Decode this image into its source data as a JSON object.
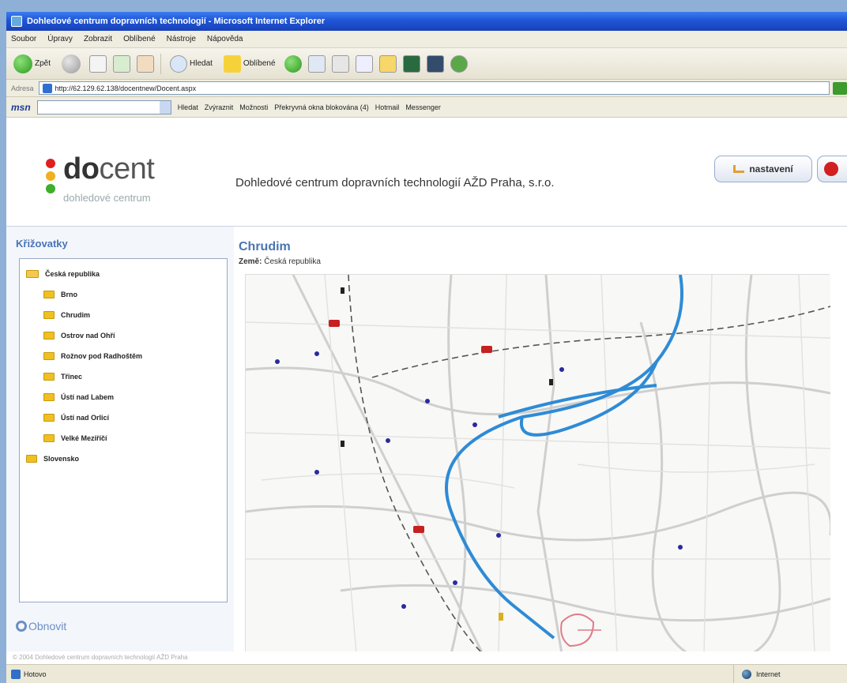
{
  "window": {
    "title": "Dohledové centrum dopravních technologií - Microsoft Internet Explorer"
  },
  "menu": [
    "Soubor",
    "Úpravy",
    "Zobrazit",
    "Oblíbené",
    "Nástroje",
    "Nápověda"
  ],
  "toolbar": {
    "back_label": "Zpět",
    "search_label": "Hledat",
    "favorites_label": "Oblíbené"
  },
  "address": {
    "label": "Adresa",
    "url": "http://62.129.62.138/docentnew/Docent.aspx"
  },
  "msn": {
    "logo": "msn",
    "search_label": "Hledat",
    "highlight_label": "Zvýraznit",
    "options_label": "Možnosti",
    "popups_label": "Překryvná okna blokována (4)",
    "hotmail_label": "Hotmail",
    "messenger_label": "Messenger"
  },
  "header": {
    "logo_bold": "do",
    "logo_rest": "cent",
    "logo_sub": "dohledové centrum",
    "company": "Dohledové centrum dopravních technologií AŽD Praha, s.r.o.",
    "settings_label": "nastavení",
    "dot_colors": [
      "#e02020",
      "#f0b020",
      "#3fae2c"
    ]
  },
  "sidebar": {
    "title": "Křižovatky",
    "tree": [
      {
        "label": "Česká republika",
        "level": 0,
        "open": true
      },
      {
        "label": "Brno",
        "level": 1
      },
      {
        "label": "Chrudim",
        "level": 1
      },
      {
        "label": "Ostrov nad Ohří",
        "level": 1
      },
      {
        "label": "Rožnov pod Radhoštěm",
        "level": 1
      },
      {
        "label": "Třinec",
        "level": 1
      },
      {
        "label": "Ústí nad Labem",
        "level": 1
      },
      {
        "label": "Ústí nad Orlicí",
        "level": 1
      },
      {
        "label": "Velké Meziříčí",
        "level": 1
      },
      {
        "label": "Slovensko",
        "level": 0
      }
    ],
    "refresh_label": "Obnovit"
  },
  "main": {
    "city": "Chrudim",
    "country_label": "Země:",
    "country_value": "Česká republika"
  },
  "footer_text": "© 2004 Dohledové centrum dopravních technologií AŽD Praha",
  "status": {
    "text": "Hotovo",
    "zone": "Internet"
  }
}
